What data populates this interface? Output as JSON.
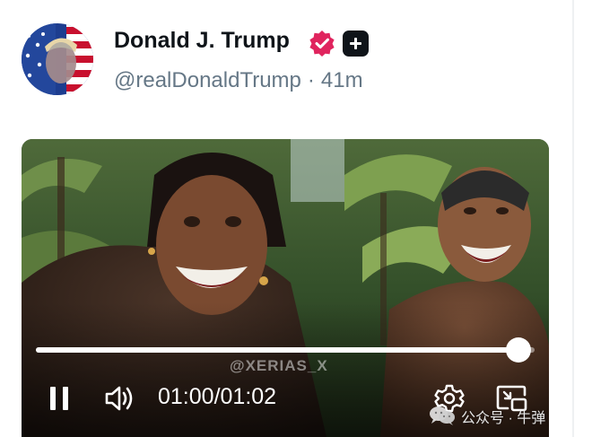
{
  "post": {
    "author_name": "Donald J. Trump",
    "handle": "@realDonaldTrump",
    "separator": "·",
    "time_ago": "41m"
  },
  "video": {
    "watermark": "@XERIAS_X",
    "current_time": "01:00",
    "time_separator": "/",
    "duration": "01:02",
    "progress": 0.968,
    "state": "playing"
  },
  "overlay": {
    "wechat_label": "公众号 · 牛弹"
  },
  "colors": {
    "verified_badge": "#e0245e",
    "text_primary": "#0f1419",
    "text_secondary": "#657786"
  },
  "icons": [
    "verified-badge-icon",
    "plus-badge-icon",
    "pause-icon",
    "volume-icon",
    "settings-icon",
    "picture-in-picture-icon",
    "wechat-icon"
  ]
}
